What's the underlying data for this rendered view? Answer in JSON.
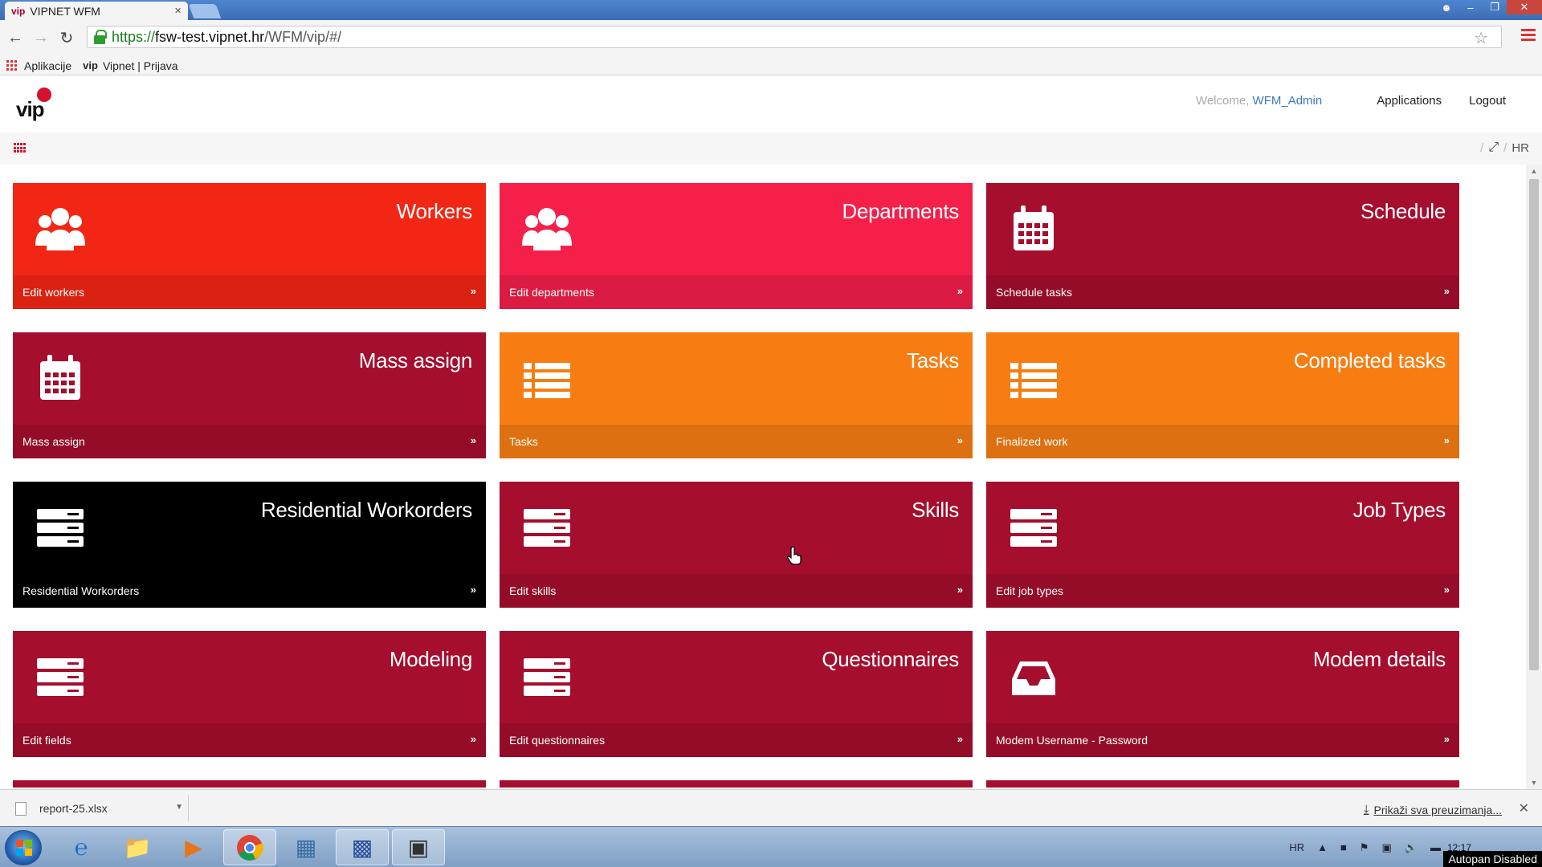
{
  "browser": {
    "tab_title": "VIPNET WFM",
    "tab_favicon": "vip",
    "tab_close": "×",
    "url_scheme": "https://",
    "url_host": "fsw-test.vipnet.hr",
    "url_path": "/WFM/vip/#/",
    "bookmarks": [
      {
        "label": "Aplikacije",
        "icon": "apps-grid-icon"
      },
      {
        "label": "Vipnet | Prijava",
        "icon": "vip"
      }
    ]
  },
  "header": {
    "logo_text": "vip",
    "welcome_prefix": "Welcome, ",
    "username": "WFM_Admin",
    "applications_label": "Applications",
    "logout_label": "Logout"
  },
  "subbar": {
    "language": "HR"
  },
  "tiles": [
    {
      "title": "Workers",
      "footer": "Edit workers",
      "icon": "users-icon",
      "color": "#f22614"
    },
    {
      "title": "Departments",
      "footer": "Edit departments",
      "icon": "users-icon",
      "color": "#f4204a"
    },
    {
      "title": "Schedule",
      "footer": "Schedule tasks",
      "icon": "calendar-icon",
      "color": "#a50e2d"
    },
    {
      "title": "Mass assign",
      "footer": "Mass assign",
      "icon": "calendar-icon",
      "color": "#a50e2d"
    },
    {
      "title": "Tasks",
      "footer": "Tasks",
      "icon": "list-icon",
      "color": "#f77d12"
    },
    {
      "title": "Completed tasks",
      "footer": "Finalized work",
      "icon": "list-icon",
      "color": "#f77d12"
    },
    {
      "title": "Residential Workorders",
      "footer": "Residential Workorders",
      "icon": "server-icon",
      "color": "#000000"
    },
    {
      "title": "Skills",
      "footer": "Edit skills",
      "icon": "server-icon",
      "color": "#a50e2d"
    },
    {
      "title": "Job Types",
      "footer": "Edit job types",
      "icon": "server-icon",
      "color": "#a50e2d"
    },
    {
      "title": "Modeling",
      "footer": "Edit fields",
      "icon": "server-icon",
      "color": "#a50e2d"
    },
    {
      "title": "Questionnaires",
      "footer": "Edit questionnaires",
      "icon": "server-icon",
      "color": "#a50e2d"
    },
    {
      "title": "Modem details",
      "footer": "Modem Username - Password",
      "icon": "inbox-icon",
      "color": "#a50e2d"
    }
  ],
  "tile_arrow": "»",
  "download_shelf": {
    "file_name": "report-25.xlsx",
    "show_all_label": "Prikaži sva preuzimanja..."
  },
  "taskbar": {
    "language": "HR",
    "time": "12:17",
    "autopan_label": "Autopan Disabled"
  }
}
